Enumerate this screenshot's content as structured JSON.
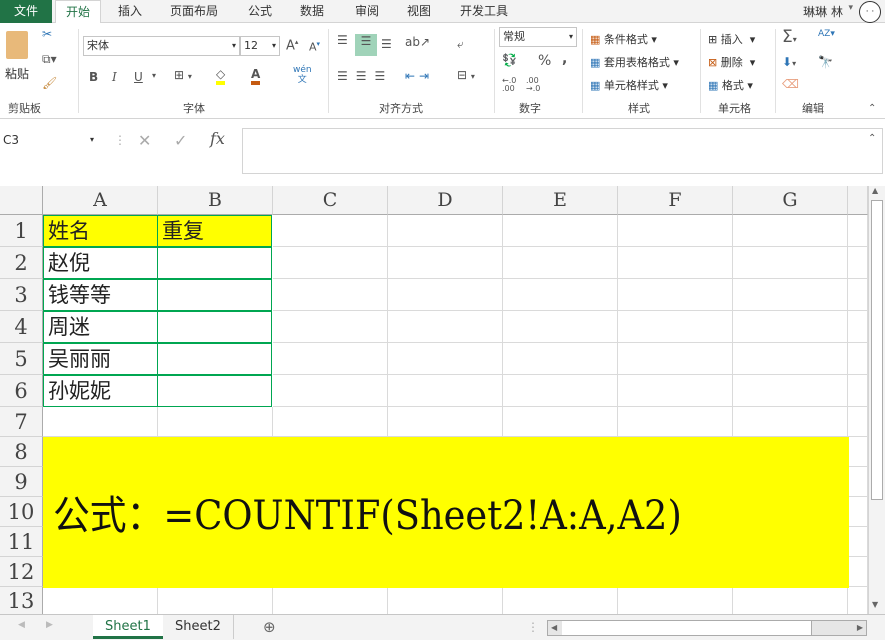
{
  "tabs": {
    "file": "文件",
    "items": [
      "开始",
      "插入",
      "页面布局",
      "公式",
      "数据",
      "审阅",
      "视图",
      "开发工具"
    ],
    "active": 0
  },
  "user": "琳琳 林",
  "ribbon": {
    "clipboard": {
      "paste": "粘贴",
      "label": "剪贴板"
    },
    "font": {
      "name": "宋体",
      "size": "12",
      "bold": "B",
      "italic": "I",
      "underline": "U",
      "label": "字体",
      "phonetic": "wén",
      "fill_color": "#ffff00",
      "font_color": "#c55a11"
    },
    "align": {
      "label": "对齐方式"
    },
    "number": {
      "format": "常规",
      "percent": "%",
      "comma": ",",
      "label": "数字"
    },
    "styles": {
      "conditional": "条件格式",
      "table": "套用表格格式",
      "cell": "单元格样式",
      "label": "样式"
    },
    "cells": {
      "insert": "插入",
      "delete": "删除",
      "format": "格式",
      "label": "单元格"
    },
    "editing": {
      "label": "编辑"
    }
  },
  "formula_bar": {
    "name_box": "C3",
    "fx": "fx",
    "value": ""
  },
  "columns": [
    "A",
    "B",
    "C",
    "D",
    "E",
    "F",
    "G"
  ],
  "rows": [
    "1",
    "2",
    "3",
    "4",
    "5",
    "6",
    "7",
    "8",
    "9",
    "10",
    "11",
    "12",
    "13"
  ],
  "cells": [
    [
      "姓名",
      "重复"
    ],
    [
      "赵倪",
      ""
    ],
    [
      "钱等等",
      ""
    ],
    [
      "周迷",
      ""
    ],
    [
      "吴丽丽",
      ""
    ],
    [
      "孙妮妮",
      ""
    ]
  ],
  "note": "公式：=COUNTIF(Sheet2!A:A,A2)",
  "sheets": [
    "Sheet1",
    "Sheet2"
  ],
  "active_sheet": 0,
  "colors": {
    "accent": "#217346",
    "highlight": "#ffff00",
    "border": "#00a651"
  }
}
